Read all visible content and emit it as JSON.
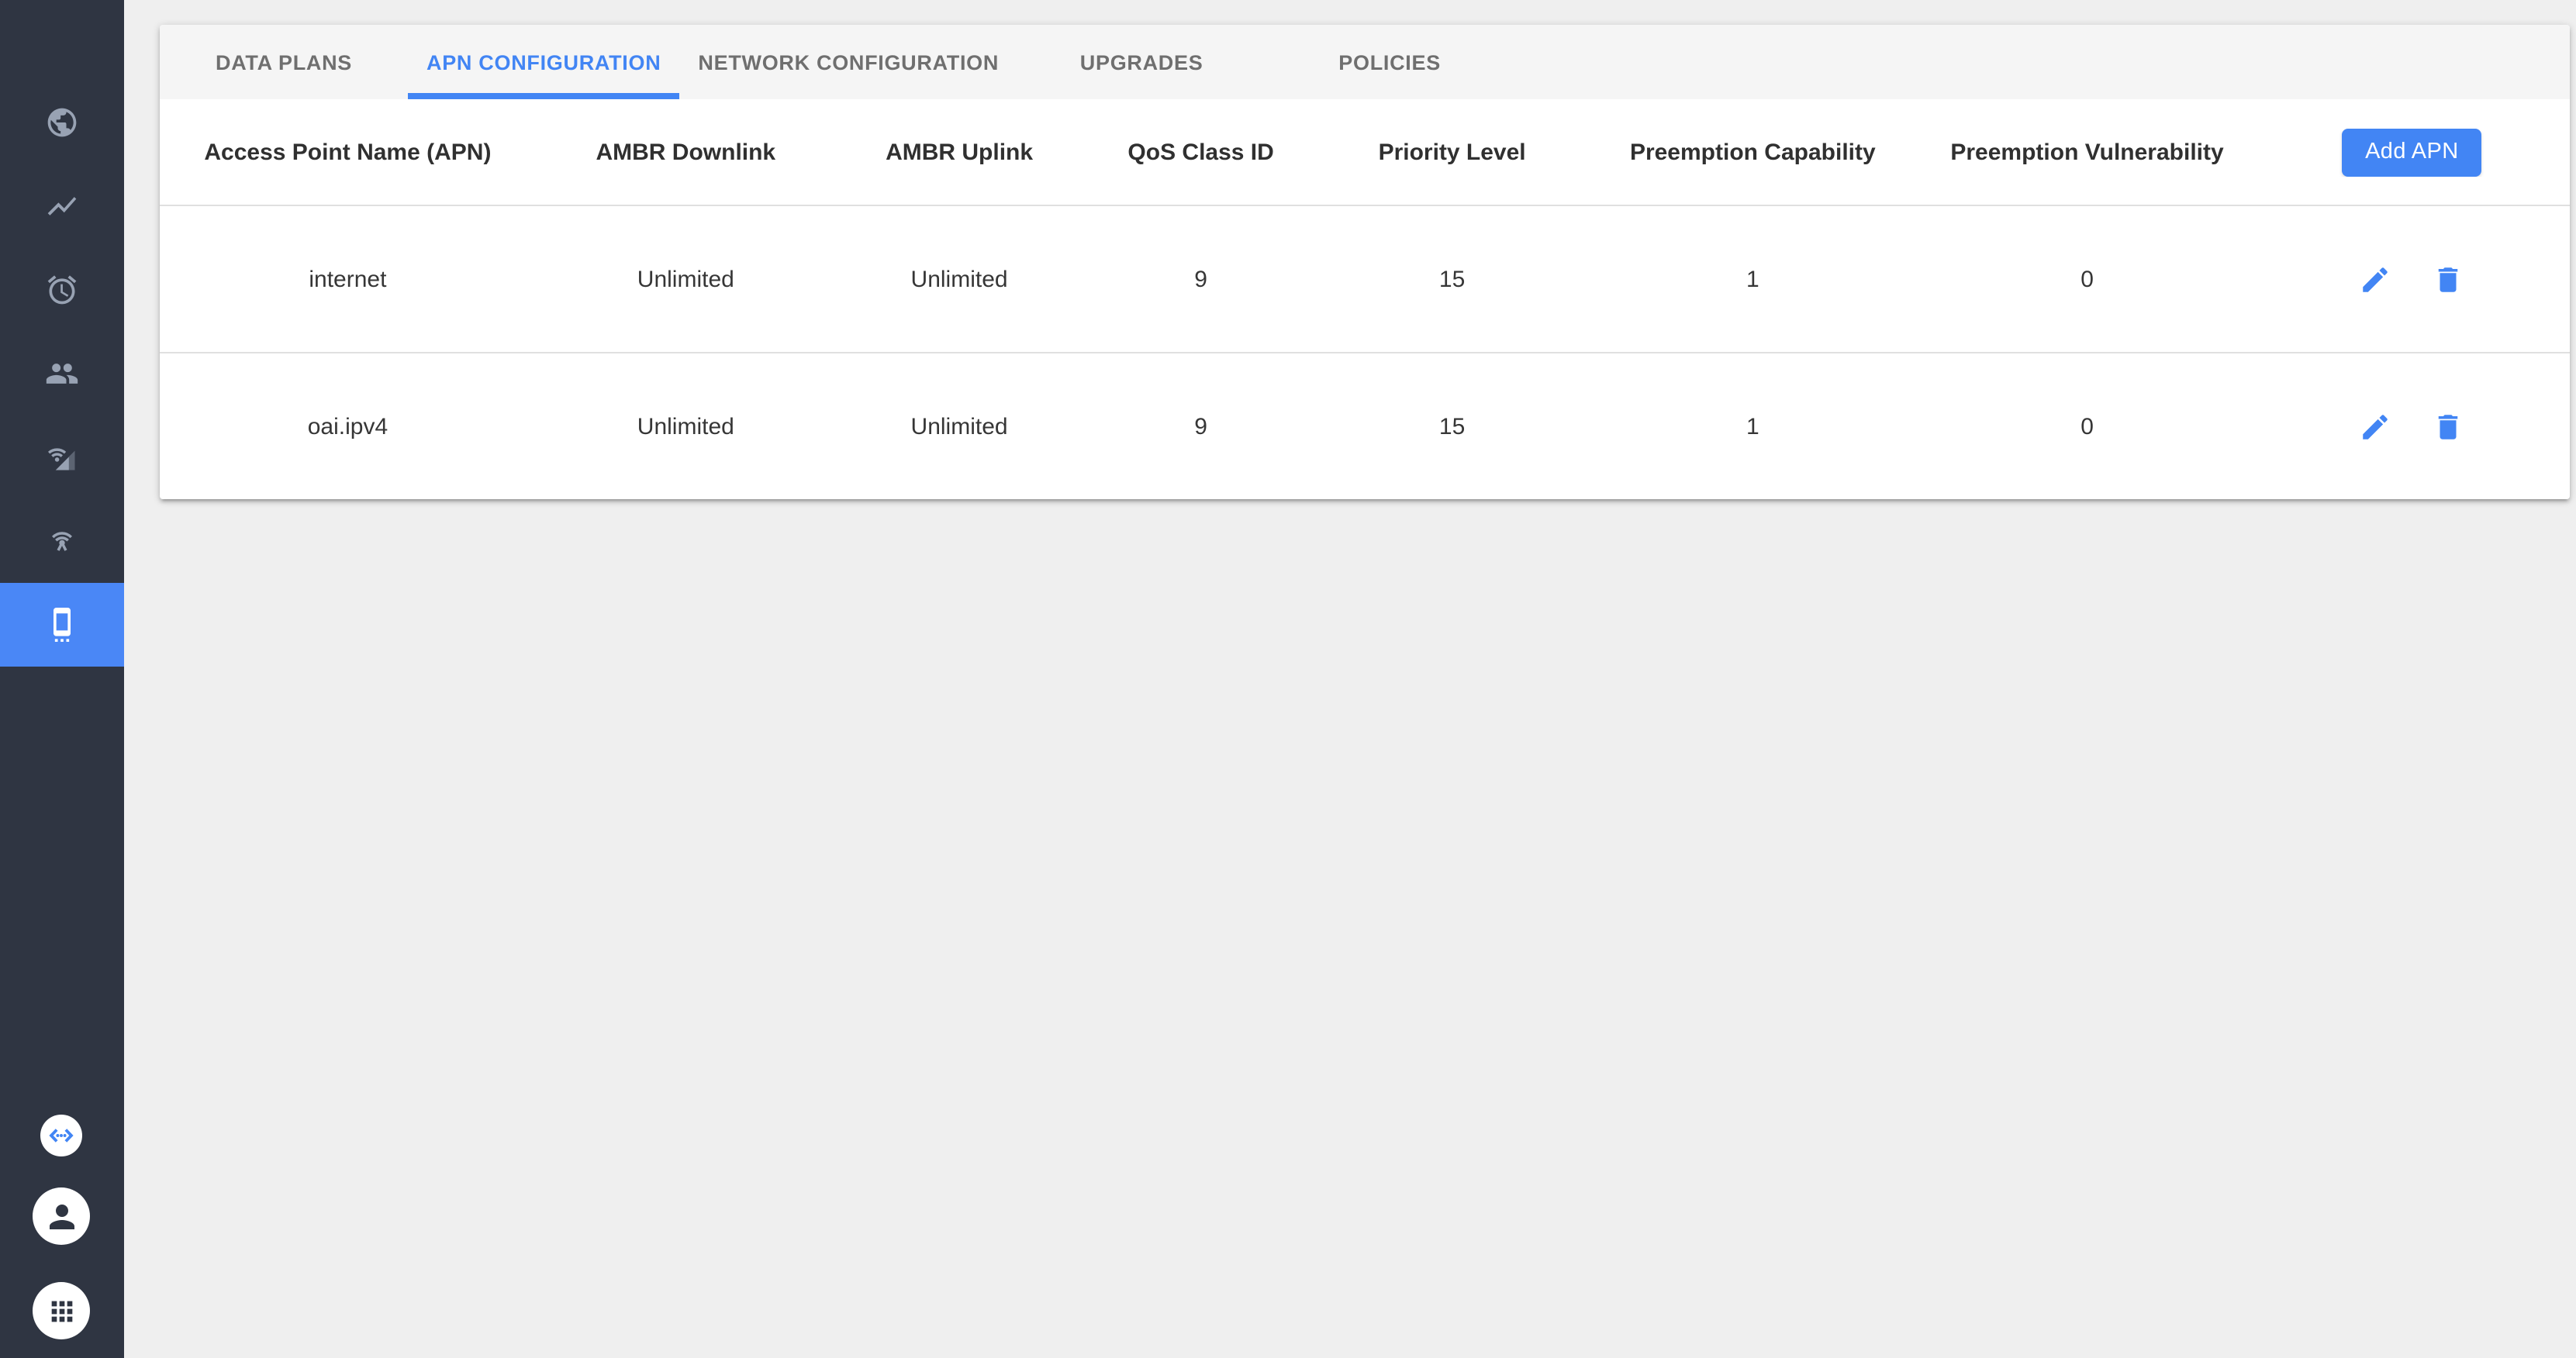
{
  "colors": {
    "accent": "#4285F4",
    "page_bg": "#EFEFEF",
    "tabbar_bg": "#F5F5F5",
    "sidebar_bg": "#2F3542",
    "sidebar_active_bg": "#4A87F6",
    "sidebar_icon": "#98A2B3",
    "tab_inactive": "#6F6F6F",
    "divider": "#E0E0E0",
    "header_text": "#303030",
    "text": "#363636"
  },
  "sidebar": {
    "items": [
      {
        "id": "network-map",
        "icon": "globe-icon",
        "active": false
      },
      {
        "id": "metrics",
        "icon": "show-chart-icon",
        "active": false
      },
      {
        "id": "alarms",
        "icon": "alarm-icon",
        "active": false
      },
      {
        "id": "subscribers",
        "icon": "people-icon",
        "active": false
      },
      {
        "id": "network",
        "icon": "cell-wifi-icon",
        "active": false
      },
      {
        "id": "gateways",
        "icon": "wifi-tethering-icon",
        "active": false
      },
      {
        "id": "configure",
        "icon": "settings-cell-icon",
        "active": true
      }
    ],
    "footer_items": [
      {
        "id": "api-docs",
        "icon": "code-icon"
      },
      {
        "id": "account",
        "icon": "person-icon"
      },
      {
        "id": "apps",
        "icon": "apps-grid-icon"
      }
    ]
  },
  "tabs": {
    "items": [
      {
        "label": "DATA PLANS",
        "active": false
      },
      {
        "label": "APN CONFIGURATION",
        "active": true
      },
      {
        "label": "NETWORK CONFIGURATION",
        "active": false
      },
      {
        "label": "UPGRADES",
        "active": false
      },
      {
        "label": "POLICIES",
        "active": false
      }
    ]
  },
  "table": {
    "headers": [
      "Access Point Name (APN)",
      "AMBR Downlink",
      "AMBR Uplink",
      "QoS Class ID",
      "Priority Level",
      "Preemption Capability",
      "Preemption Vulnerability"
    ],
    "add_button_label": "Add APN",
    "rows": [
      {
        "apn": "internet",
        "ambr_downlink": "Unlimited",
        "ambr_uplink": "Unlimited",
        "qos_class_id": "9",
        "priority_level": "15",
        "preemption_capability": "1",
        "preemption_vulnerability": "0"
      },
      {
        "apn": "oai.ipv4",
        "ambr_downlink": "Unlimited",
        "ambr_uplink": "Unlimited",
        "qos_class_id": "9",
        "priority_level": "15",
        "preemption_capability": "1",
        "preemption_vulnerability": "0"
      }
    ]
  }
}
